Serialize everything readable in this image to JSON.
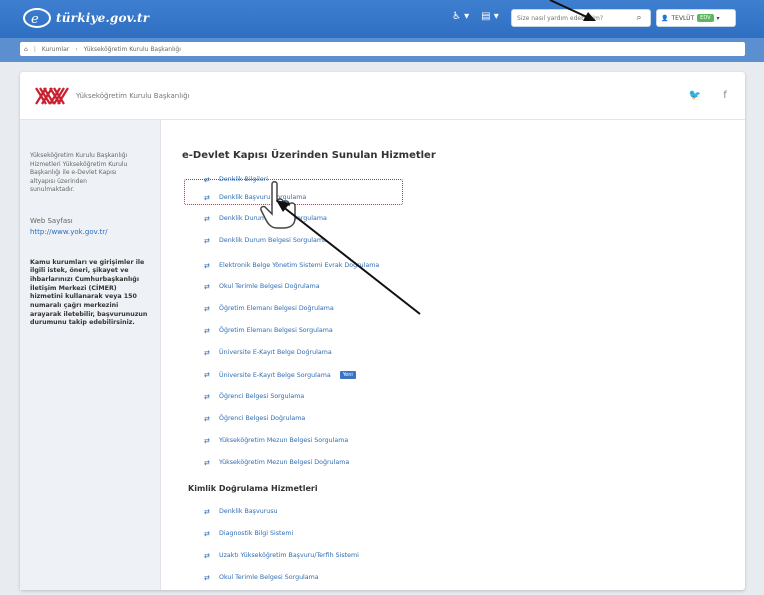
{
  "header": {
    "logo_text": "türkiye.gov.tr",
    "icons": [
      "accessibility-icon",
      "language-icon",
      "settings-icon"
    ],
    "search_placeholder": "Size nasıl yardım edebilirim?",
    "login_label": "TEVLÜT",
    "login_badge": "EDV"
  },
  "breadcrumb": {
    "items": [
      "Kurumlar",
      "Yükseköğretim Kurulu Başkanlığı"
    ]
  },
  "institution": {
    "name": "Yükseköğretim Kurulu Başkanlığı",
    "social": [
      "twitter-icon",
      "facebook-icon"
    ]
  },
  "sidebar": {
    "description": "Yükseköğretim Kurulu Başkanlığı Hizmetleri Yükseköğretim Kurulu Başkanlığı ile e-Devlet Kapısı altyapısı üzerinden sunulmaktadır.",
    "web_label": "Web Sayfası",
    "web_link": "http://www.yok.gov.tr/",
    "note": "Kamu kurumları ve girişimler ile ilgili istek, öneri, şikayet ve ihbarlarınızı Cumhurbaşkanlığı İletişim Merkezi (CİMER) hizmetini kullanarak veya 150 numaralı çağrı merkezini arayarak iletebilir, başvurunuzun durumunu takip edebilirsiniz."
  },
  "main": {
    "section1_title": "e-Devlet Kapısı Üzerinden Sunulan Hizmetler",
    "services1": [
      {
        "label": "Denklik Bilgileri",
        "new": false
      },
      {
        "label": "Denklik Başvuru Sorgulama",
        "new": false
      },
      {
        "label": "Denklik Durum Belgesi Sorgulama",
        "new": false
      },
      {
        "label": "Denklik Durum Belgesi Sorgulama",
        "new": false
      },
      {
        "label": "Elektronik Belge Yönetim Sistemi Evrak Doğrulama",
        "new": false
      },
      {
        "label": "Okul Terimle Belgesi Doğrulama",
        "new": false
      },
      {
        "label": "Öğretim Elemanı Belgesi Doğrulama",
        "new": false
      },
      {
        "label": "Öğretim Elemanı Belgesi Sorgulama",
        "new": false
      },
      {
        "label": "Üniversite E-Kayıt Belge Doğrulama",
        "new": false
      },
      {
        "label": "Üniversite E-Kayıt Belge Sorgulama",
        "new": true
      },
      {
        "label": "Öğrenci Belgesi Sorgulama",
        "new": false
      },
      {
        "label": "Öğrenci Belgesi Doğrulama",
        "new": false
      },
      {
        "label": "Yükseköğretim Mezun Belgesi Sorgulama",
        "new": false
      },
      {
        "label": "Yükseköğretim Mezun Belgesi Doğrulama",
        "new": false
      }
    ],
    "new_badge": "Yeni",
    "section2_title": "Kimlik Doğrulama Hizmetleri",
    "services2": [
      {
        "label": "Denklik Başvurusu"
      },
      {
        "label": "Diagnostik Bilgi Sistemi"
      },
      {
        "label": "Uzaktı Yükseköğretim Başvuru/Terfih Sistemi"
      },
      {
        "label": "Okul Terimle Belgesi Sorgulama"
      }
    ]
  }
}
